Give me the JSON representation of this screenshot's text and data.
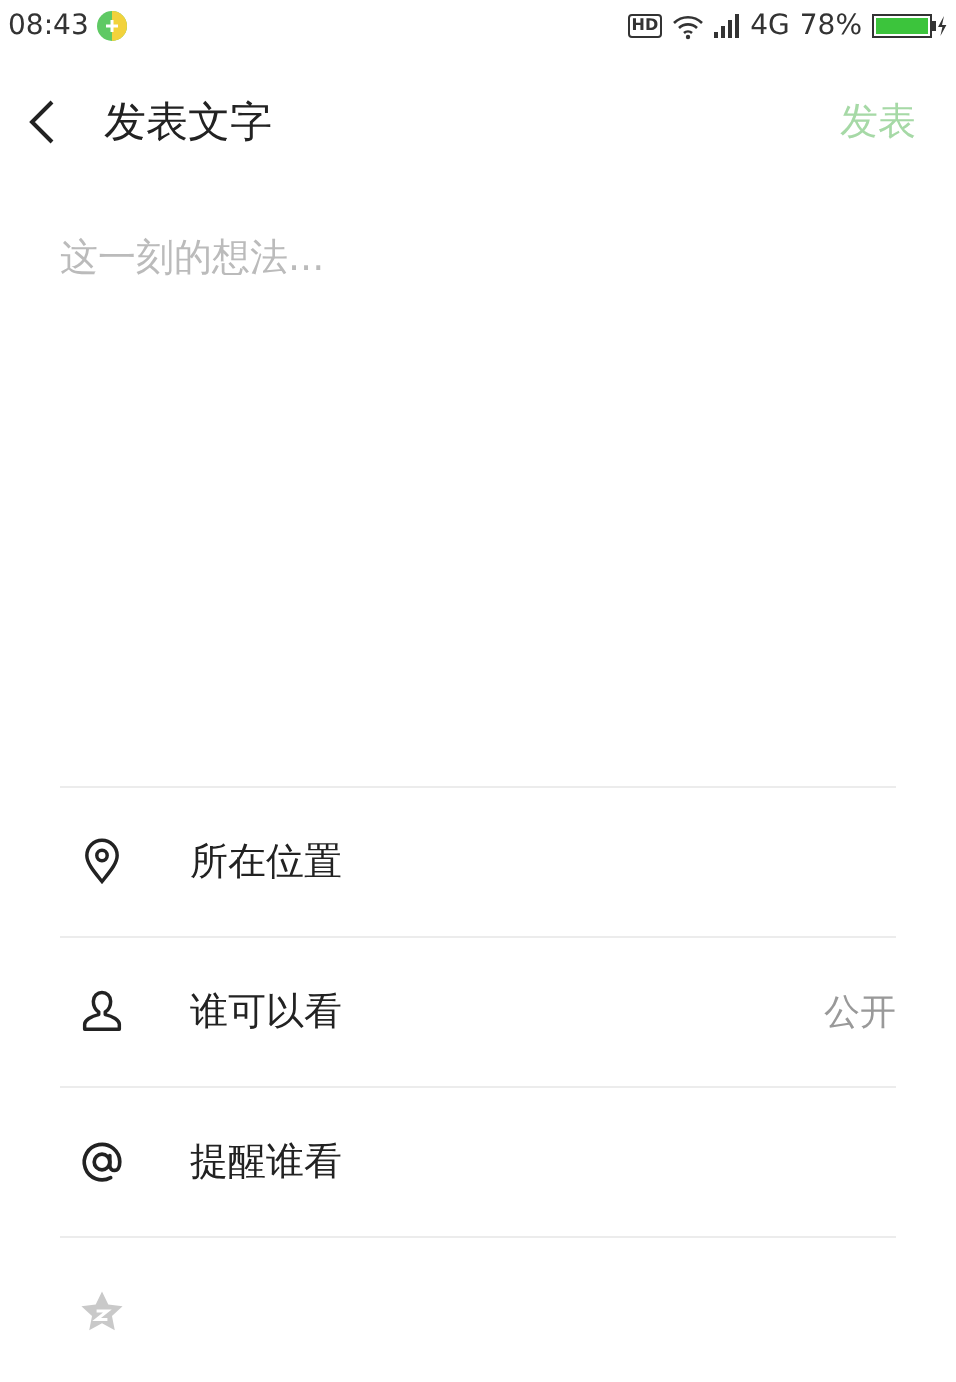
{
  "status_bar": {
    "time": "08:43",
    "hd": "HD",
    "network": "4G",
    "battery": "78%"
  },
  "header": {
    "title": "发表文字",
    "action": "发表"
  },
  "compose": {
    "placeholder": "这一刻的想法..."
  },
  "options": [
    {
      "kind": "location",
      "label": "所在位置"
    },
    {
      "kind": "person",
      "label": "谁可以看",
      "value": "公开"
    },
    {
      "kind": "mention",
      "label": "提醒谁看"
    },
    {
      "kind": "star"
    }
  ]
}
